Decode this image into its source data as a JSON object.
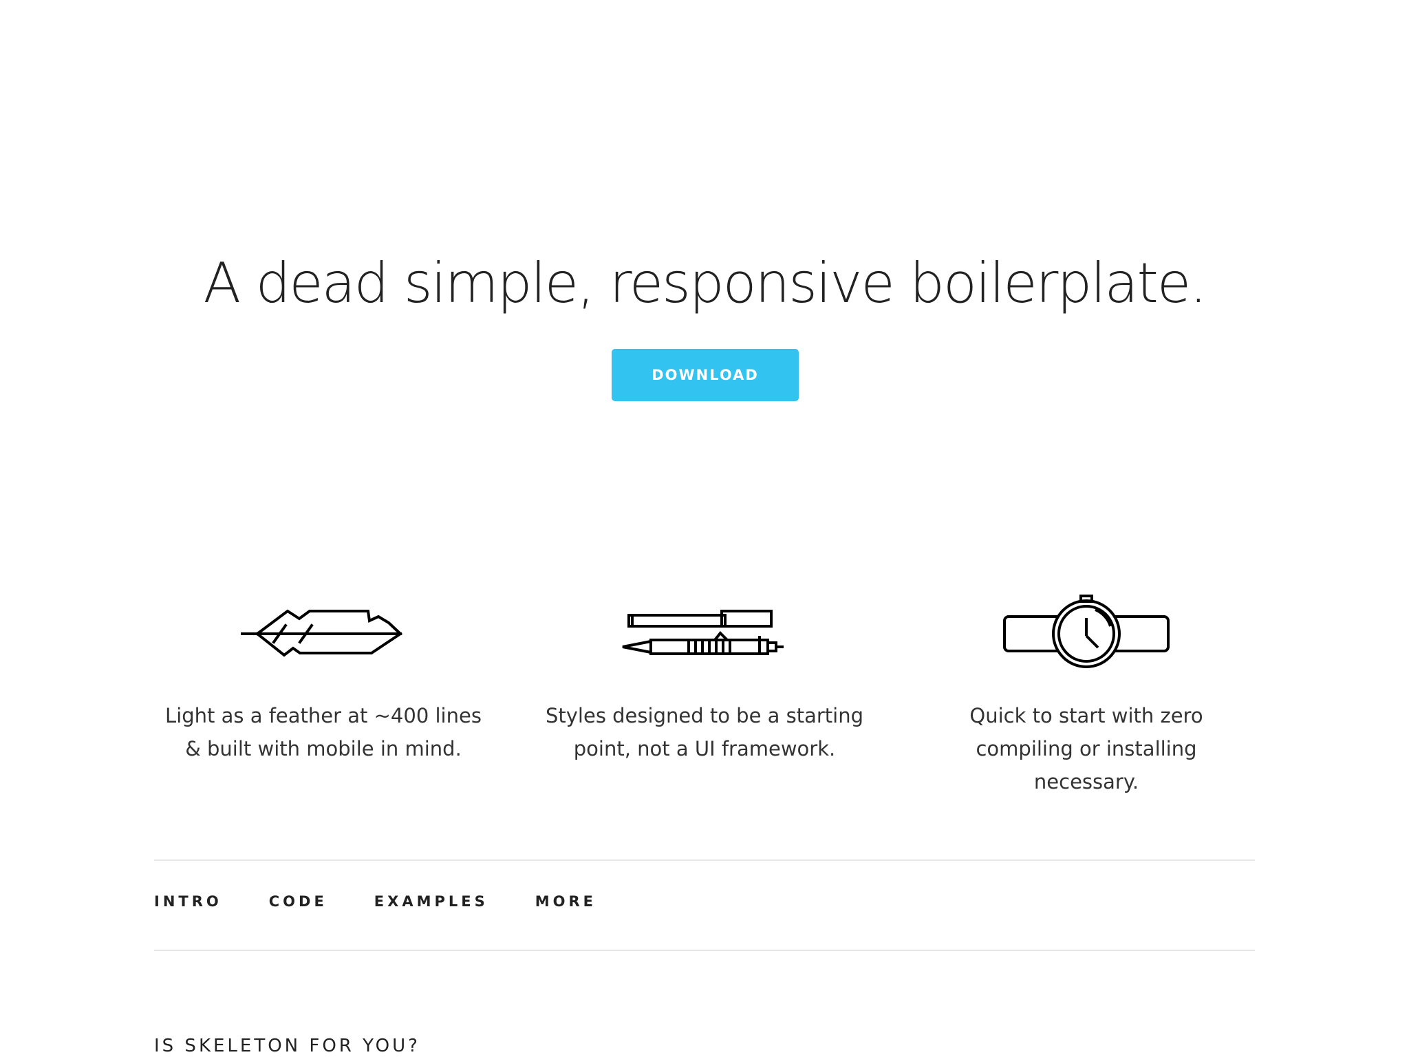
{
  "hero": {
    "title": "A dead simple, responsive boilerplate.",
    "download_label": "DOWNLOAD"
  },
  "colors": {
    "accent": "#33c3f0",
    "text": "#222222",
    "divider": "#e6e6e6"
  },
  "features": [
    {
      "icon": "feather-icon",
      "text": "Light as a feather at ~400 lines & built with mobile in mind."
    },
    {
      "icon": "pens-icon",
      "text": "Styles designed to be a starting point, not a UI framework."
    },
    {
      "icon": "watch-icon",
      "text": "Quick to start with zero compiling or installing necessary."
    }
  ],
  "nav": {
    "items": [
      "INTRO",
      "CODE",
      "EXAMPLES",
      "MORE"
    ]
  },
  "section": {
    "heading": "IS SKELETON FOR YOU?"
  }
}
